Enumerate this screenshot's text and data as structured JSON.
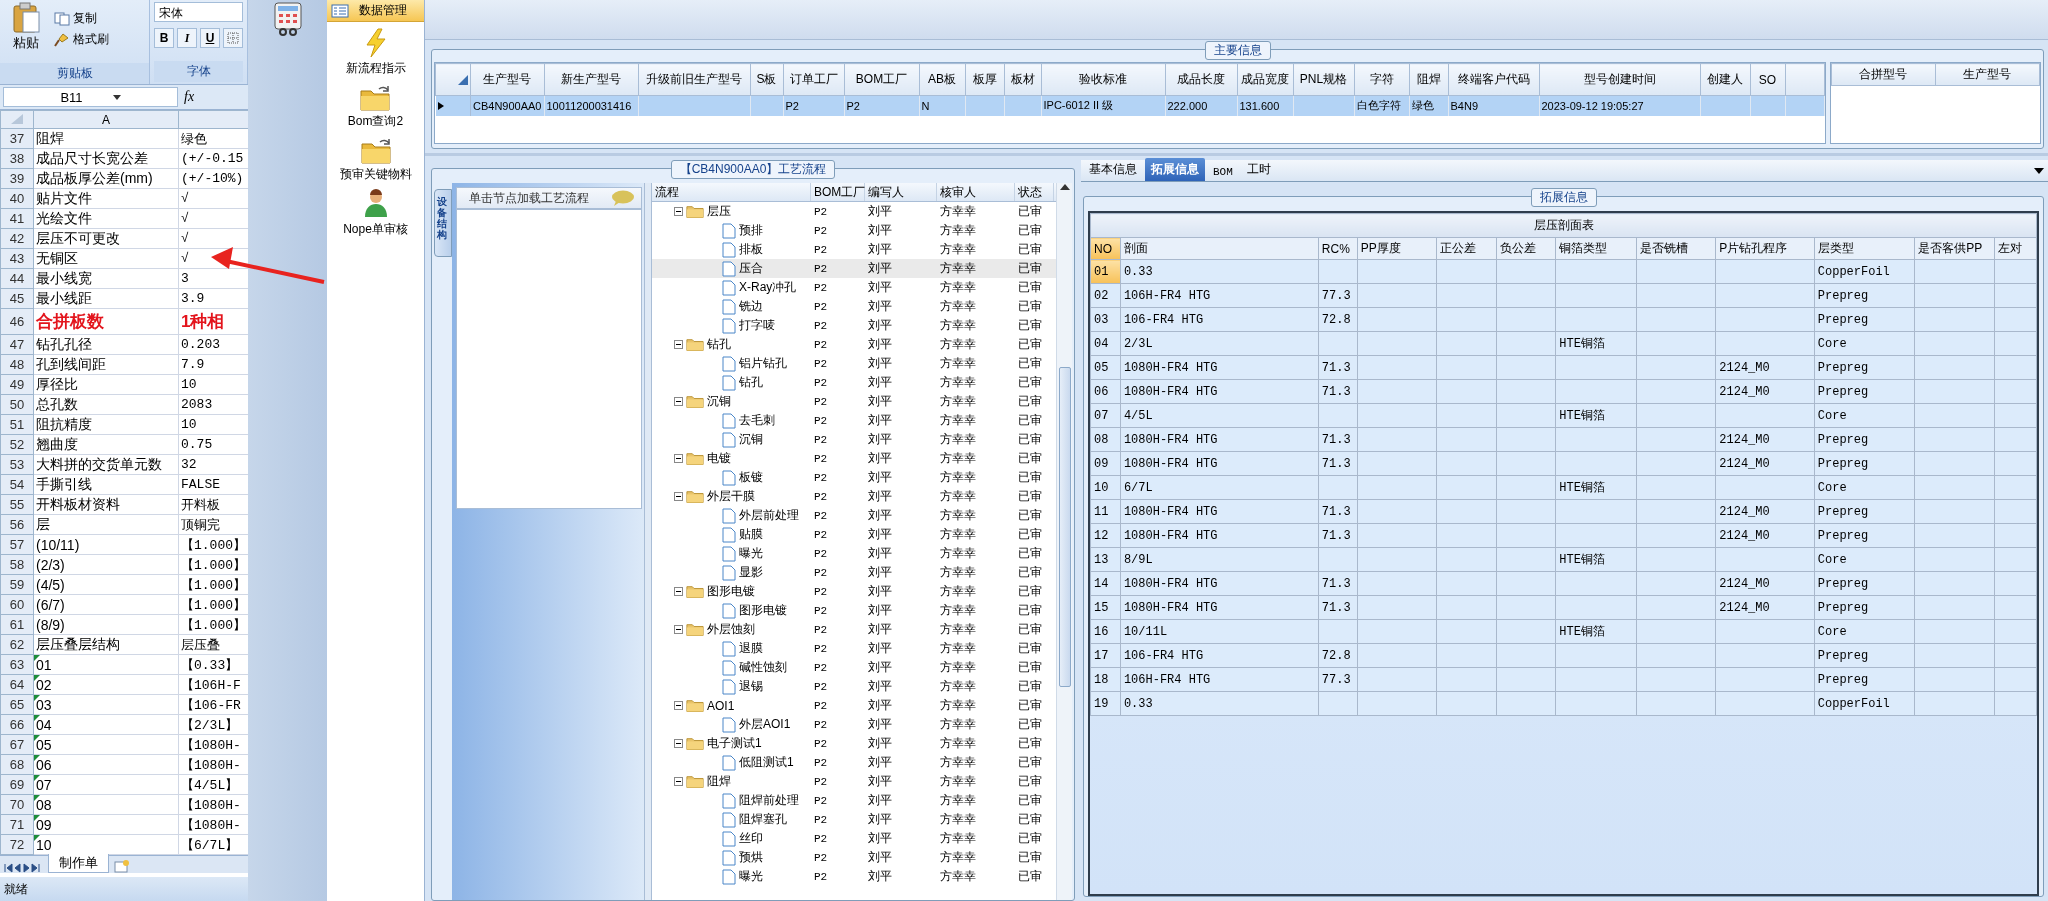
{
  "excel": {
    "ribbon": {
      "paste": "粘贴",
      "copy": "复制",
      "format_painter": "格式刷",
      "clipboard_group": "剪贴板",
      "font_name": "宋体",
      "bold": "B",
      "italic": "I",
      "underline": "U",
      "font_group": "字体"
    },
    "name_box": "B11",
    "fx": "fx",
    "column_header": "A",
    "rows": [
      {
        "num": "37",
        "a": "阻焊",
        "b": "绿色",
        "kind": "plain"
      },
      {
        "num": "38",
        "a": "成品尺寸长宽公差",
        "b": "(+/-0.15",
        "kind": "plain"
      },
      {
        "num": "39",
        "a": "成品板厚公差(mm)",
        "b": "(+/-10%)",
        "kind": "plain"
      },
      {
        "num": "40",
        "a": "贴片文件",
        "b": "√",
        "kind": "plain"
      },
      {
        "num": "41",
        "a": "光绘文件",
        "b": "√",
        "kind": "plain"
      },
      {
        "num": "42",
        "a": "层压不可更改",
        "b": "√",
        "kind": "plain"
      },
      {
        "num": "43",
        "a": "无铜区",
        "b": "√",
        "kind": "plain"
      },
      {
        "num": "44",
        "a": "最小线宽",
        "b": "3",
        "kind": "plain"
      },
      {
        "num": "45",
        "a": "最小线距",
        "b": "3.9",
        "kind": "plain"
      },
      {
        "num": "46",
        "a": "合拼板数",
        "b": "1种相",
        "kind": "emphasis"
      },
      {
        "num": "47",
        "a": "钻孔孔径",
        "b": "0.203",
        "kind": "plain"
      },
      {
        "num": "48",
        "a": "孔到线间距",
        "b": "7.9",
        "kind": "plain"
      },
      {
        "num": "49",
        "a": "厚径比",
        "b": "10",
        "kind": "plain"
      },
      {
        "num": "50",
        "a": "总孔数",
        "b": "2083",
        "kind": "plain"
      },
      {
        "num": "51",
        "a": "阻抗精度",
        "b": "10",
        "kind": "plain"
      },
      {
        "num": "52",
        "a": "翘曲度",
        "b": "0.75",
        "kind": "plain"
      },
      {
        "num": "53",
        "a": "大料拼的交货单元数",
        "b": "32",
        "kind": "plain"
      },
      {
        "num": "54",
        "a": "手撕引线",
        "b": "FALSE",
        "kind": "plain"
      },
      {
        "num": "55",
        "a": "开料板材资料",
        "b": "开料板",
        "kind": "plain"
      },
      {
        "num": "56",
        "a": "层",
        "b": "顶铜完",
        "kind": "plain"
      },
      {
        "num": "57",
        "a": "(10/11)",
        "b": "【1.000】",
        "kind": "plain"
      },
      {
        "num": "58",
        "a": "(2/3)",
        "b": "【1.000】",
        "kind": "plain"
      },
      {
        "num": "59",
        "a": "(4/5)",
        "b": "【1.000】",
        "kind": "plain"
      },
      {
        "num": "60",
        "a": "(6/7)",
        "b": "【1.000】",
        "kind": "plain"
      },
      {
        "num": "61",
        "a": "(8/9)",
        "b": "【1.000】",
        "kind": "plain"
      },
      {
        "num": "62",
        "a": "层压叠层结构",
        "b": "层压叠",
        "kind": "plain"
      },
      {
        "num": "63",
        "a": "01",
        "b": "【0.33】",
        "kind": "textnum"
      },
      {
        "num": "64",
        "a": "02",
        "b": "【106H-F",
        "kind": "textnum"
      },
      {
        "num": "65",
        "a": "03",
        "b": "【106-FR",
        "kind": "textnum"
      },
      {
        "num": "66",
        "a": "04",
        "b": "【2/3L】",
        "kind": "textnum"
      },
      {
        "num": "67",
        "a": "05",
        "b": "【1080H-",
        "kind": "textnum"
      },
      {
        "num": "68",
        "a": "06",
        "b": "【1080H-",
        "kind": "textnum"
      },
      {
        "num": "69",
        "a": "07",
        "b": "【4/5L】",
        "kind": "textnum"
      },
      {
        "num": "70",
        "a": "08",
        "b": "【1080H-",
        "kind": "textnum"
      },
      {
        "num": "71",
        "a": "09",
        "b": "【1080H-",
        "kind": "textnum"
      },
      {
        "num": "72",
        "a": "10",
        "b": "【6/7L】",
        "kind": "textnum"
      }
    ],
    "sheet_tab": "制作单",
    "status": "就绪"
  },
  "nav": {
    "header": "数据管理",
    "items": [
      {
        "label": "新流程指示",
        "kind": "flash"
      },
      {
        "label": "Bom查询2",
        "kind": "folder"
      },
      {
        "label": "预审关键物料",
        "kind": "folder"
      },
      {
        "label": "Nope单审核",
        "kind": "user"
      }
    ]
  },
  "main_info": {
    "title": "主要信息",
    "columns": [
      "生产型号",
      "新生产型号",
      "升级前旧生产型号",
      "S板",
      "订单工厂",
      "BOM工厂",
      "AB板",
      "板厚",
      "板材",
      "验收标准",
      "成品长度",
      "成品宽度",
      "PNL规格",
      "字符",
      "阻焊",
      "终端客户代码",
      "型号创建时间",
      "创建人",
      "SO"
    ],
    "rows": [
      {
        "selected": true,
        "cells": [
          "CB4N900AA0",
          "10011200031416",
          null,
          null,
          "P2",
          "P2",
          "N",
          null,
          null,
          "IPC-6012 II 级",
          "222.000",
          "131.600",
          null,
          "白色字符",
          "绿色",
          "B4N9",
          "2023-09-12 19:05:27",
          null,
          null
        ]
      }
    ],
    "merge_columns": [
      "合拼型号",
      "生产型号"
    ]
  },
  "process": {
    "title": "【CB4N900AA0】工艺流程",
    "side_tab": "设备结构",
    "hint": "单击节点加载工艺流程",
    "columns": [
      "流程",
      "BOM工厂",
      "编写人",
      "核审人",
      "状态"
    ],
    "tree": [
      {
        "name": "层压",
        "bom": "P2",
        "author": "刘平",
        "reviewer": "方幸幸",
        "status": "已审",
        "selected": false,
        "children": [
          {
            "name": "预排",
            "bom": "P2",
            "author": "刘平",
            "reviewer": "方幸幸",
            "status": "已审",
            "selected": false
          },
          {
            "name": "排板",
            "bom": "P2",
            "author": "刘平",
            "reviewer": "方幸幸",
            "status": "已审",
            "selected": false
          },
          {
            "name": "压合",
            "bom": "P2",
            "author": "刘平",
            "reviewer": "方幸幸",
            "status": "已审",
            "selected": true
          },
          {
            "name": "X-Ray冲孔",
            "bom": "P2",
            "author": "刘平",
            "reviewer": "方幸幸",
            "status": "已审",
            "selected": false
          },
          {
            "name": "铣边",
            "bom": "P2",
            "author": "刘平",
            "reviewer": "方幸幸",
            "status": "已审",
            "selected": false
          },
          {
            "name": "打字唛",
            "bom": "P2",
            "author": "刘平",
            "reviewer": "方幸幸",
            "status": "已审",
            "selected": false
          }
        ]
      },
      {
        "name": "钻孔",
        "bom": "P2",
        "author": "刘平",
        "reviewer": "方幸幸",
        "status": "已审",
        "selected": false,
        "children": [
          {
            "name": "铝片钻孔",
            "bom": "P2",
            "author": "刘平",
            "reviewer": "方幸幸",
            "status": "已审",
            "selected": false
          },
          {
            "name": "钻孔",
            "bom": "P2",
            "author": "刘平",
            "reviewer": "方幸幸",
            "status": "已审",
            "selected": false
          }
        ]
      },
      {
        "name": "沉铜",
        "bom": "P2",
        "author": "刘平",
        "reviewer": "方幸幸",
        "status": "已审",
        "selected": false,
        "children": [
          {
            "name": "去毛刺",
            "bom": "P2",
            "author": "刘平",
            "reviewer": "方幸幸",
            "status": "已审",
            "selected": false
          },
          {
            "name": "沉铜",
            "bom": "P2",
            "author": "刘平",
            "reviewer": "方幸幸",
            "status": "已审",
            "selected": false
          }
        ]
      },
      {
        "name": "电镀",
        "bom": "P2",
        "author": "刘平",
        "reviewer": "方幸幸",
        "status": "已审",
        "selected": false,
        "children": [
          {
            "name": "板镀",
            "bom": "P2",
            "author": "刘平",
            "reviewer": "方幸幸",
            "status": "已审",
            "selected": false
          }
        ]
      },
      {
        "name": "外层干膜",
        "bom": "P2",
        "author": "刘平",
        "reviewer": "方幸幸",
        "status": "已审",
        "selected": false,
        "children": [
          {
            "name": "外层前处理",
            "bom": "P2",
            "author": "刘平",
            "reviewer": "方幸幸",
            "status": "已审",
            "selected": false
          },
          {
            "name": "贴膜",
            "bom": "P2",
            "author": "刘平",
            "reviewer": "方幸幸",
            "status": "已审",
            "selected": false
          },
          {
            "name": "曝光",
            "bom": "P2",
            "author": "刘平",
            "reviewer": "方幸幸",
            "status": "已审",
            "selected": false
          },
          {
            "name": "显影",
            "bom": "P2",
            "author": "刘平",
            "reviewer": "方幸幸",
            "status": "已审",
            "selected": false
          }
        ]
      },
      {
        "name": "图形电镀",
        "bom": "P2",
        "author": "刘平",
        "reviewer": "方幸幸",
        "status": "已审",
        "selected": false,
        "children": [
          {
            "name": "图形电镀",
            "bom": "P2",
            "author": "刘平",
            "reviewer": "方幸幸",
            "status": "已审",
            "selected": false
          }
        ]
      },
      {
        "name": "外层蚀刻",
        "bom": "P2",
        "author": "刘平",
        "reviewer": "方幸幸",
        "status": "已审",
        "selected": false,
        "children": [
          {
            "name": "退膜",
            "bom": "P2",
            "author": "刘平",
            "reviewer": "方幸幸",
            "status": "已审",
            "selected": false
          },
          {
            "name": "碱性蚀刻",
            "bom": "P2",
            "author": "刘平",
            "reviewer": "方幸幸",
            "status": "已审",
            "selected": false
          },
          {
            "name": "退锡",
            "bom": "P2",
            "author": "刘平",
            "reviewer": "方幸幸",
            "status": "已审",
            "selected": false
          }
        ]
      },
      {
        "name": "AOI1",
        "bom": "P2",
        "author": "刘平",
        "reviewer": "方幸幸",
        "status": "已审",
        "selected": false,
        "children": [
          {
            "name": "外层AOI1",
            "bom": "P2",
            "author": "刘平",
            "reviewer": "方幸幸",
            "status": "已审",
            "selected": false
          }
        ]
      },
      {
        "name": "电子测试1",
        "bom": "P2",
        "author": "刘平",
        "reviewer": "方幸幸",
        "status": "已审",
        "selected": false,
        "children": [
          {
            "name": "低阻测试1",
            "bom": "P2",
            "author": "刘平",
            "reviewer": "方幸幸",
            "status": "已审",
            "selected": false
          }
        ]
      },
      {
        "name": "阻焊",
        "bom": "P2",
        "author": "刘平",
        "reviewer": "方幸幸",
        "status": "已审",
        "selected": false,
        "children": [
          {
            "name": "阻焊前处理",
            "bom": "P2",
            "author": "刘平",
            "reviewer": "方幸幸",
            "status": "已审",
            "selected": false
          },
          {
            "name": "阻焊塞孔",
            "bom": "P2",
            "author": "刘平",
            "reviewer": "方幸幸",
            "status": "已审",
            "selected": false
          },
          {
            "name": "丝印",
            "bom": "P2",
            "author": "刘平",
            "reviewer": "方幸幸",
            "status": "已审",
            "selected": false
          },
          {
            "name": "预烘",
            "bom": "P2",
            "author": "刘平",
            "reviewer": "方幸幸",
            "status": "已审",
            "selected": false
          },
          {
            "name": "曝光",
            "bom": "P2",
            "author": "刘平",
            "reviewer": "方幸幸",
            "status": "已审",
            "selected": false
          }
        ]
      }
    ]
  },
  "detail": {
    "tabs": [
      {
        "label": "基本信息",
        "selected": false
      },
      {
        "label": "拓展信息",
        "selected": true
      },
      {
        "label": "BOM",
        "selected": false
      },
      {
        "label": "工时",
        "selected": false
      }
    ],
    "group_title": "拓展信息",
    "table_title": "层压剖面表",
    "columns": [
      "NO",
      "剖面",
      "RC%",
      "PP厚度",
      "正公差",
      "负公差",
      "铜箔类型",
      "是否铣槽",
      "P片钻孔程序",
      "层类型",
      "是否客供PP",
      "左对"
    ],
    "rows": [
      {
        "selected": true,
        "cells": [
          "01",
          "0.33",
          null,
          null,
          null,
          null,
          null,
          null,
          null,
          "CopperFoil",
          null,
          null
        ]
      },
      {
        "selected": false,
        "cells": [
          "02",
          "106H-FR4 HTG",
          "77.3",
          null,
          null,
          null,
          null,
          null,
          null,
          "Prepreg",
          null,
          null
        ]
      },
      {
        "selected": false,
        "cells": [
          "03",
          "106-FR4 HTG",
          "72.8",
          null,
          null,
          null,
          null,
          null,
          null,
          "Prepreg",
          null,
          null
        ]
      },
      {
        "selected": false,
        "cells": [
          "04",
          "2/3L",
          null,
          null,
          null,
          null,
          "HTE铜箔",
          null,
          null,
          "Core",
          null,
          null
        ]
      },
      {
        "selected": false,
        "cells": [
          "05",
          "1080H-FR4 HTG",
          "71.3",
          null,
          null,
          null,
          null,
          null,
          "2124_M0",
          "Prepreg",
          null,
          null
        ]
      },
      {
        "selected": false,
        "cells": [
          "06",
          "1080H-FR4 HTG",
          "71.3",
          null,
          null,
          null,
          null,
          null,
          "2124_M0",
          "Prepreg",
          null,
          null
        ]
      },
      {
        "selected": false,
        "cells": [
          "07",
          "4/5L",
          null,
          null,
          null,
          null,
          "HTE铜箔",
          null,
          null,
          "Core",
          null,
          null
        ]
      },
      {
        "selected": false,
        "cells": [
          "08",
          "1080H-FR4 HTG",
          "71.3",
          null,
          null,
          null,
          null,
          null,
          "2124_M0",
          "Prepreg",
          null,
          null
        ]
      },
      {
        "selected": false,
        "cells": [
          "09",
          "1080H-FR4 HTG",
          "71.3",
          null,
          null,
          null,
          null,
          null,
          "2124_M0",
          "Prepreg",
          null,
          null
        ]
      },
      {
        "selected": false,
        "cells": [
          "10",
          "6/7L",
          null,
          null,
          null,
          null,
          "HTE铜箔",
          null,
          null,
          "Core",
          null,
          null
        ]
      },
      {
        "selected": false,
        "cells": [
          "11",
          "1080H-FR4 HTG",
          "71.3",
          null,
          null,
          null,
          null,
          null,
          "2124_M0",
          "Prepreg",
          null,
          null
        ]
      },
      {
        "selected": false,
        "cells": [
          "12",
          "1080H-FR4 HTG",
          "71.3",
          null,
          null,
          null,
          null,
          null,
          "2124_M0",
          "Prepreg",
          null,
          null
        ]
      },
      {
        "selected": false,
        "cells": [
          "13",
          "8/9L",
          null,
          null,
          null,
          null,
          "HTE铜箔",
          null,
          null,
          "Core",
          null,
          null
        ]
      },
      {
        "selected": false,
        "cells": [
          "14",
          "1080H-FR4 HTG",
          "71.3",
          null,
          null,
          null,
          null,
          null,
          "2124_M0",
          "Prepreg",
          null,
          null
        ]
      },
      {
        "selected": false,
        "cells": [
          "15",
          "1080H-FR4 HTG",
          "71.3",
          null,
          null,
          null,
          null,
          null,
          "2124_M0",
          "Prepreg",
          null,
          null
        ]
      },
      {
        "selected": false,
        "cells": [
          "16",
          "10/11L",
          null,
          null,
          null,
          null,
          "HTE铜箔",
          null,
          null,
          "Core",
          null,
          null
        ]
      },
      {
        "selected": false,
        "cells": [
          "17",
          "106-FR4 HTG",
          "72.8",
          null,
          null,
          null,
          null,
          null,
          null,
          "Prepreg",
          null,
          null
        ]
      },
      {
        "selected": false,
        "cells": [
          "18",
          "106H-FR4 HTG",
          "77.3",
          null,
          null,
          null,
          null,
          null,
          null,
          "Prepreg",
          null,
          null
        ]
      },
      {
        "selected": false,
        "cells": [
          "19",
          "0.33",
          null,
          null,
          null,
          null,
          null,
          null,
          null,
          "CopperFoil",
          null,
          null
        ]
      }
    ]
  }
}
